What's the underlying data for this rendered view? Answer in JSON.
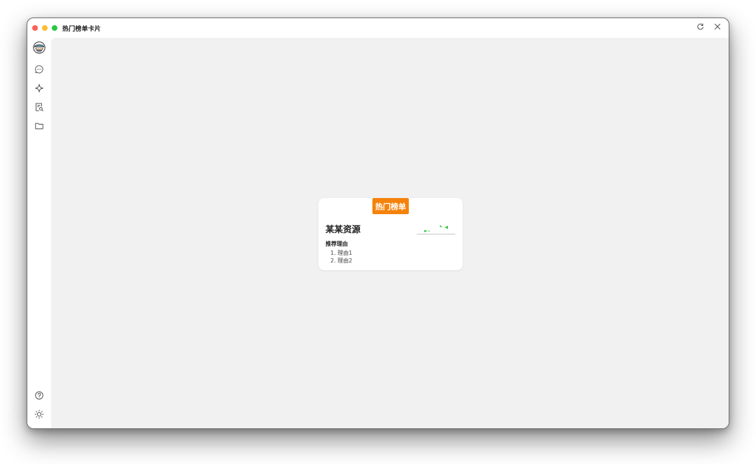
{
  "window": {
    "title": "热门榜单卡片"
  },
  "titlebar": {
    "refresh_icon": "refresh-icon",
    "close_icon": "close-icon"
  },
  "sidebar": {
    "top_items": [
      "avatar",
      "chat-icon",
      "sparkle-icon",
      "document-search-icon",
      "folder-icon"
    ],
    "bottom_items": [
      "help-icon",
      "theme-sun-icon",
      "settings-icon"
    ]
  },
  "card": {
    "badge": "热门榜单",
    "title": "某某资源",
    "reason_heading": "推荐理由",
    "reasons": [
      "1. 理由1",
      "2. 理由2"
    ],
    "accent_color": "#f5820a",
    "decoration_color": "#3cc84b"
  }
}
